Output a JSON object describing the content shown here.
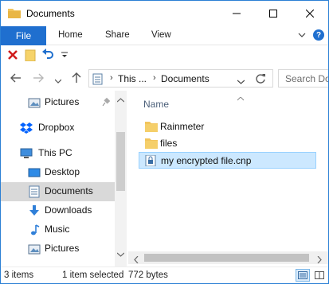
{
  "window": {
    "title": "Documents"
  },
  "ribbon": {
    "file": "File",
    "home": "Home",
    "share": "Share",
    "view": "View"
  },
  "address": {
    "segments": [
      "This ...",
      "Documents"
    ]
  },
  "search": {
    "placeholder": "Search Documents"
  },
  "nav": {
    "items": [
      {
        "label": "Pictures",
        "icon": "pictures-icon",
        "pinned": true
      },
      {
        "label": "Dropbox",
        "icon": "dropbox-icon"
      },
      {
        "label": "This PC",
        "icon": "this-pc-icon"
      },
      {
        "label": "Desktop",
        "icon": "desktop-icon"
      },
      {
        "label": "Documents",
        "icon": "documents-icon",
        "selected": true
      },
      {
        "label": "Downloads",
        "icon": "downloads-icon"
      },
      {
        "label": "Music",
        "icon": "music-icon"
      },
      {
        "label": "Pictures",
        "icon": "pictures-icon"
      }
    ]
  },
  "content": {
    "column_name": "Name",
    "files": [
      {
        "name": "Rainmeter",
        "type": "folder"
      },
      {
        "name": "files",
        "type": "folder"
      },
      {
        "name": "my encrypted file.cnp",
        "type": "encrypted-file",
        "selected": true
      }
    ]
  },
  "status": {
    "count": "3 items",
    "selected": "1 item selected",
    "size": "772 bytes"
  },
  "colors": {
    "accent": "#1f6fcf",
    "selection": "#cce8ff",
    "folder": "#f2c55c"
  }
}
